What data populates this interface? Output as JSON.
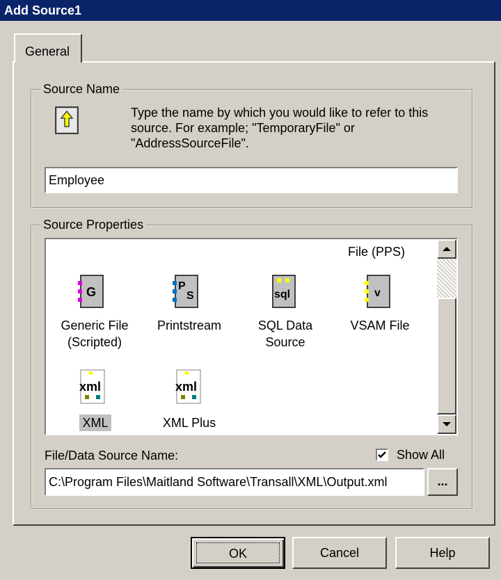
{
  "window": {
    "title": "Add Source1"
  },
  "tabs": [
    {
      "label": "General"
    }
  ],
  "source_name": {
    "group_label": "Source Name",
    "instructions": "Type the name by which you would like to refer to this source.  For example; \"TemporaryFile\" or \"AddressSourceFile\".",
    "value": "Employee"
  },
  "source_properties": {
    "group_label": "Source Properties",
    "partial_item_label": "File (PPS)",
    "items": [
      {
        "label": "Generic File (Scripted)",
        "icon": "generic-file-icon"
      },
      {
        "label": "Printstream",
        "icon": "printstream-icon"
      },
      {
        "label": "SQL Data Source",
        "icon": "sql-data-source-icon"
      },
      {
        "label": "VSAM File",
        "icon": "vsam-file-icon"
      },
      {
        "label": "XML",
        "icon": "xml-icon",
        "selected": true
      },
      {
        "label": "XML Plus",
        "icon": "xml-plus-icon"
      }
    ],
    "file_label": "File/Data Source Name:",
    "show_all_label": "Show All",
    "show_all_checked": true,
    "file_path": "C:\\Program Files\\Maitland Software\\Transall\\XML\\Output.xml",
    "browse_label": "..."
  },
  "buttons": {
    "ok": "OK",
    "cancel": "Cancel",
    "help": "Help"
  },
  "colors": {
    "titlebar": "#0a246a",
    "face": "#d4d0c8"
  }
}
